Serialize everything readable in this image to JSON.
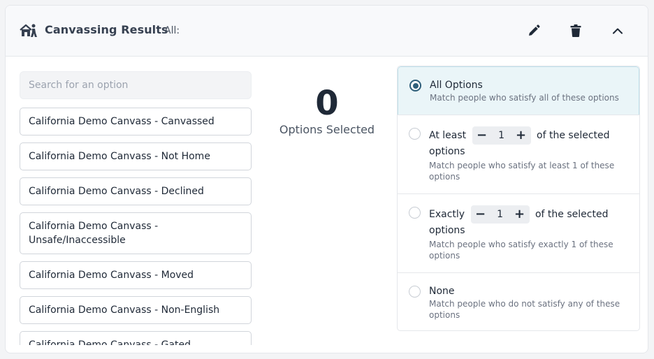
{
  "header": {
    "title": "Canvassing Results",
    "filter_label": "All:",
    "icon": "canvasser-house-icon",
    "actions": [
      "edit-icon",
      "trash-icon",
      "chevron-up-icon"
    ]
  },
  "search": {
    "placeholder": "Search for an option",
    "value": ""
  },
  "options": [
    "California Demo Canvass - Canvassed",
    "California Demo Canvass - Not Home",
    "California Demo Canvass - Declined",
    "California Demo Canvass - Unsafe/Inaccessible",
    "California Demo Canvass - Moved",
    "California Demo Canvass - Non-English",
    "California Demo Canvass - Gated"
  ],
  "selection": {
    "count": "0",
    "label": "Options Selected"
  },
  "match": {
    "all": {
      "title": "All Options",
      "desc": "Match people who satisfy all of these options",
      "checked": true
    },
    "at_least": {
      "prefix": "At least",
      "value": "1",
      "suffix": "of the selected",
      "suffix2": "options",
      "desc": "Match people who satisfy at least 1 of these options"
    },
    "exactly": {
      "prefix": "Exactly",
      "value": "1",
      "suffix": "of the selected",
      "suffix2": "options",
      "desc": "Match people who satisfy exactly 1 of these options"
    },
    "none": {
      "title": "None",
      "desc": "Match people who do not satisfy any of these options"
    },
    "minus": "−",
    "plus": "+"
  },
  "colors": {
    "accent": "#2f5f7a",
    "selected_bg": "#eaf5f8"
  }
}
